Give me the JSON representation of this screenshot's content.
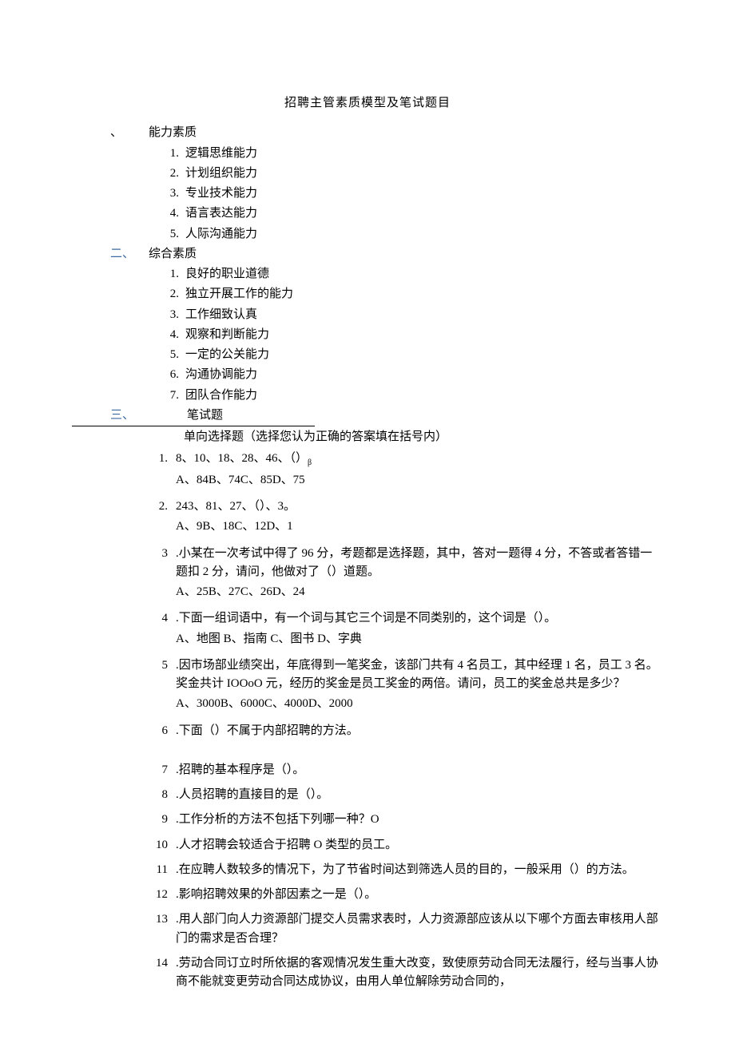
{
  "title": "招聘主管素质模型及笔试题目",
  "sections": {
    "s1": {
      "num": "、",
      "label": "能力素质",
      "items": [
        "逻辑思维能力",
        "计划组织能力",
        "专业技术能力",
        "语言表达能力",
        "人际沟通能力"
      ]
    },
    "s2": {
      "num": "二、",
      "label": "综合素质",
      "items": [
        "良好的职业道德",
        "独立开展工作的能力",
        "工作细致认真",
        "观察和判断能力",
        "一定的公关能力",
        "沟通协调能力",
        "团队合作能力"
      ]
    },
    "s3": {
      "num": "三、",
      "label": "笔试题",
      "subtitle": "单向选择题（选择您认为正确的答案填在括号内）"
    }
  },
  "questions": [
    {
      "num": "1.",
      "stem": "8、10、18、28、46、（）",
      "sub": "β",
      "opts": "A、84B、74C、85D、75"
    },
    {
      "num": "2.",
      "stem": "243、81、27、（）、3。",
      "opts": "A、9B、18C、12D、1"
    },
    {
      "num": "3",
      "dot": ".",
      "stem": "小某在一次考试中得了 96 分，考题都是选择题，其中，答对一题得 4 分，不答或者答错一题扣 2 分，请问，他做对了（）道题。",
      "opts": "A、25B、27C、26D、24"
    },
    {
      "num": "4",
      "dot": ".",
      "stem": "下面一组词语中，有一个词与其它三个词是不同类别的，这个词是（）。",
      "opts": "A、地图 B、指南 C、图书 D、字典"
    },
    {
      "num": "5",
      "dot": ".",
      "stem": "因市场部业绩突出，年底得到一笔奖金，该部门共有 4 名员工，其中经理 1 名，员工 3 名。奖金共计 IOOoO 元，经历的奖金是员工奖金的两倍。请问，员工的奖金总共是多少？",
      "opts": "A、3000B、6000C、4000D、2000"
    },
    {
      "num": "6",
      "dot": ".",
      "stem": "下面（）不属于内部招聘的方法。"
    },
    {
      "num": "7",
      "dot": ".",
      "stem": "招聘的基本程序是（）。"
    },
    {
      "num": "8",
      "dot": ".",
      "stem": "人员招聘的直接目的是（）。"
    },
    {
      "num": "9",
      "dot": ".",
      "stem": "工作分析的方法不包括下列哪一种？O"
    },
    {
      "num": "10",
      "dot": ".",
      "stem": "人才招聘会较适合于招聘 O 类型的员工。"
    },
    {
      "num": "11",
      "dot": ".",
      "stem": "在应聘人数较多的情况下，为了节省时间达到筛选人员的目的，一般采用（）的方法。"
    },
    {
      "num": "12",
      "dot": ".",
      "stem": "影响招聘效果的外部因素之一是（）。"
    },
    {
      "num": "13",
      "dot": ".",
      "stem": "用人部门向人力资源部门提交人员需求表时，人力资源部应该从以下哪个方面去审核用人部门的需求是否合理？"
    },
    {
      "num": "14",
      "dot": ".",
      "stem": "劳动合同订立时所依据的客观情况发生重大改变，致使原劳动合同无法履行，经与当事人协商不能就变更劳动合同达成协议，由用人单位解除劳动合同的，"
    }
  ]
}
